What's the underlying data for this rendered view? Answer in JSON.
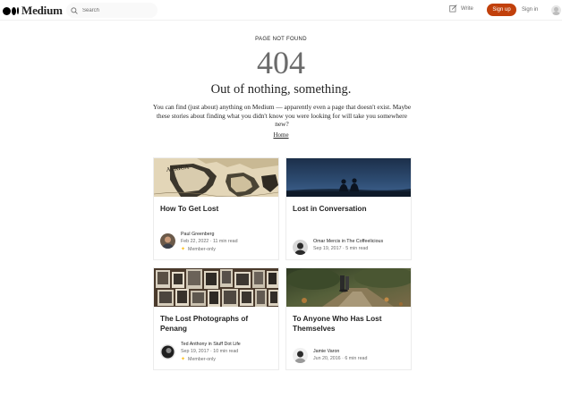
{
  "header": {
    "logo_text": "Medium",
    "search_placeholder": "Search",
    "write_label": "Write",
    "signup_label": "Sign up",
    "signin_label": "Sign in"
  },
  "hero": {
    "kicker": "PAGE NOT FOUND",
    "code": "404",
    "headline": "Out of nothing, something.",
    "description": "You can find (just about) anything on Medium — apparently even a page that doesn't exist. Maybe these stories about finding what you didn't know you were looking for will take you somewhere new?",
    "home_link": "Home"
  },
  "stories": [
    {
      "title": "How To Get Lost",
      "author": "Paul Greenberg",
      "date": "Feb 22, 2022",
      "read_time": "11 min read",
      "member_only": "Member-only",
      "image": "vintage-map-africa"
    },
    {
      "title": "Lost in Conversation",
      "author": "Omar Mercis in The Coffeelicious",
      "date": "Sep 19, 2017",
      "read_time": "5 min read",
      "member_only": "",
      "image": "two-people-sitting-at-dusk"
    },
    {
      "title": "The Lost Photographs of Penang",
      "author": "Ted Anthony in Stuff Dot Life",
      "date": "Sep 19, 2017",
      "read_time": "10 min read",
      "member_only": "Member-only",
      "image": "old-photo-collection"
    },
    {
      "title": "To Anyone Who Has Lost Themselves",
      "author": "Jamie Varon",
      "date": "Jun 20, 2016",
      "read_time": "6 min read",
      "member_only": "",
      "image": "forest-path-walker"
    }
  ],
  "colors": {
    "signup_bg": "#c1400b",
    "text_primary": "#242424",
    "text_secondary": "#6b6b6b",
    "member_star": "#ffc017"
  },
  "separator": "·"
}
